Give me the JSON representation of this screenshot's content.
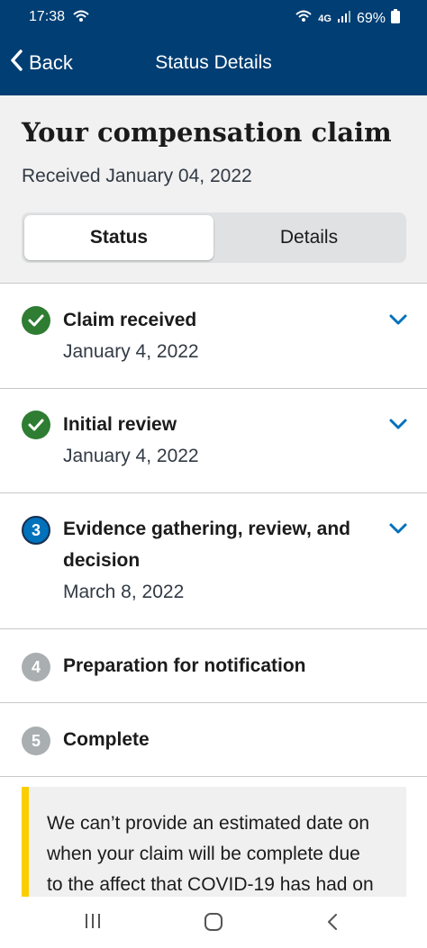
{
  "status_bar": {
    "time": "17:38",
    "network": "4G",
    "battery": "69%"
  },
  "header": {
    "back_label": "Back",
    "title": "Status Details"
  },
  "hero": {
    "title": "Your compensation claim",
    "received": "Received January 04, 2022",
    "tabs": [
      {
        "label": "Status",
        "selected": true
      },
      {
        "label": "Details",
        "selected": false
      }
    ]
  },
  "steps": [
    {
      "number": "1",
      "title": "Claim received",
      "date": "January 4, 2022",
      "state": "complete"
    },
    {
      "number": "2",
      "title": "Initial review",
      "date": "January 4, 2022",
      "state": "complete"
    },
    {
      "number": "3",
      "title_line1": "Evidence gathering, review, and",
      "title_line2": "decision",
      "date": "March 8, 2022",
      "state": "current"
    },
    {
      "number": "4",
      "title": "Preparation for notification",
      "state": "upcoming"
    },
    {
      "number": "5",
      "title": "Complete",
      "state": "upcoming"
    }
  ],
  "alert": {
    "line1": "We can’t provide an estimated date on",
    "line2": "when your claim will be complete due",
    "line3": "to the affect that COVID-19 has had on"
  },
  "colors": {
    "header_bg": "#003e73",
    "complete": "#2e7d32",
    "current": "#0071bb",
    "upcoming": "#a9aeb1",
    "alert_accent": "#face00"
  }
}
